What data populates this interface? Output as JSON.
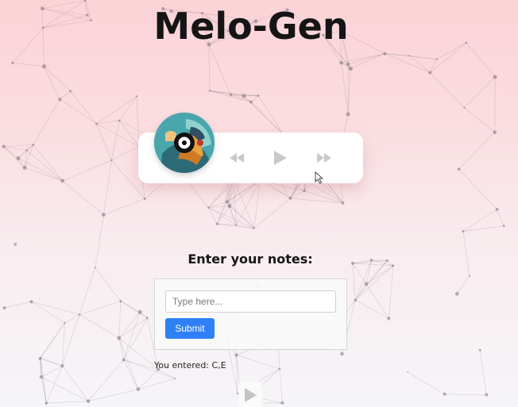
{
  "app": {
    "title": "Melo-Gen"
  },
  "player": {
    "album_art_icon": "album-cover-image",
    "controls": [
      "rewind-icon",
      "play-icon",
      "fast-forward-icon"
    ],
    "control_color": "#c9c9c9"
  },
  "notes_form": {
    "heading": "Enter your notes:",
    "input_placeholder": "Type here...",
    "input_value": "",
    "submit_label": "Submit",
    "accent_color": "#2f80f6"
  },
  "result": {
    "prefix": "You entered: ",
    "value": "C,E"
  },
  "bottom_player": {
    "icon": "play-icon"
  }
}
